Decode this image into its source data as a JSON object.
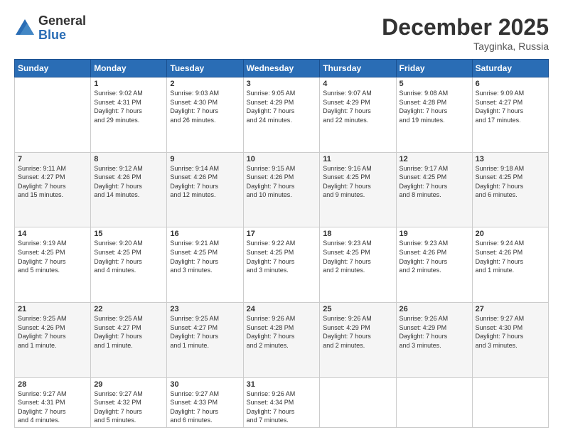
{
  "logo": {
    "general": "General",
    "blue": "Blue"
  },
  "header": {
    "month": "December 2025",
    "location": "Tayginka, Russia"
  },
  "weekdays": [
    "Sunday",
    "Monday",
    "Tuesday",
    "Wednesday",
    "Thursday",
    "Friday",
    "Saturday"
  ],
  "weeks": [
    [
      {
        "day": "",
        "info": ""
      },
      {
        "day": "1",
        "info": "Sunrise: 9:02 AM\nSunset: 4:31 PM\nDaylight: 7 hours\nand 29 minutes."
      },
      {
        "day": "2",
        "info": "Sunrise: 9:03 AM\nSunset: 4:30 PM\nDaylight: 7 hours\nand 26 minutes."
      },
      {
        "day": "3",
        "info": "Sunrise: 9:05 AM\nSunset: 4:29 PM\nDaylight: 7 hours\nand 24 minutes."
      },
      {
        "day": "4",
        "info": "Sunrise: 9:07 AM\nSunset: 4:29 PM\nDaylight: 7 hours\nand 22 minutes."
      },
      {
        "day": "5",
        "info": "Sunrise: 9:08 AM\nSunset: 4:28 PM\nDaylight: 7 hours\nand 19 minutes."
      },
      {
        "day": "6",
        "info": "Sunrise: 9:09 AM\nSunset: 4:27 PM\nDaylight: 7 hours\nand 17 minutes."
      }
    ],
    [
      {
        "day": "7",
        "info": "Sunrise: 9:11 AM\nSunset: 4:27 PM\nDaylight: 7 hours\nand 15 minutes."
      },
      {
        "day": "8",
        "info": "Sunrise: 9:12 AM\nSunset: 4:26 PM\nDaylight: 7 hours\nand 14 minutes."
      },
      {
        "day": "9",
        "info": "Sunrise: 9:14 AM\nSunset: 4:26 PM\nDaylight: 7 hours\nand 12 minutes."
      },
      {
        "day": "10",
        "info": "Sunrise: 9:15 AM\nSunset: 4:26 PM\nDaylight: 7 hours\nand 10 minutes."
      },
      {
        "day": "11",
        "info": "Sunrise: 9:16 AM\nSunset: 4:25 PM\nDaylight: 7 hours\nand 9 minutes."
      },
      {
        "day": "12",
        "info": "Sunrise: 9:17 AM\nSunset: 4:25 PM\nDaylight: 7 hours\nand 8 minutes."
      },
      {
        "day": "13",
        "info": "Sunrise: 9:18 AM\nSunset: 4:25 PM\nDaylight: 7 hours\nand 6 minutes."
      }
    ],
    [
      {
        "day": "14",
        "info": "Sunrise: 9:19 AM\nSunset: 4:25 PM\nDaylight: 7 hours\nand 5 minutes."
      },
      {
        "day": "15",
        "info": "Sunrise: 9:20 AM\nSunset: 4:25 PM\nDaylight: 7 hours\nand 4 minutes."
      },
      {
        "day": "16",
        "info": "Sunrise: 9:21 AM\nSunset: 4:25 PM\nDaylight: 7 hours\nand 3 minutes."
      },
      {
        "day": "17",
        "info": "Sunrise: 9:22 AM\nSunset: 4:25 PM\nDaylight: 7 hours\nand 3 minutes."
      },
      {
        "day": "18",
        "info": "Sunrise: 9:23 AM\nSunset: 4:25 PM\nDaylight: 7 hours\nand 2 minutes."
      },
      {
        "day": "19",
        "info": "Sunrise: 9:23 AM\nSunset: 4:26 PM\nDaylight: 7 hours\nand 2 minutes."
      },
      {
        "day": "20",
        "info": "Sunrise: 9:24 AM\nSunset: 4:26 PM\nDaylight: 7 hours\nand 1 minute."
      }
    ],
    [
      {
        "day": "21",
        "info": "Sunrise: 9:25 AM\nSunset: 4:26 PM\nDaylight: 7 hours\nand 1 minute."
      },
      {
        "day": "22",
        "info": "Sunrise: 9:25 AM\nSunset: 4:27 PM\nDaylight: 7 hours\nand 1 minute."
      },
      {
        "day": "23",
        "info": "Sunrise: 9:25 AM\nSunset: 4:27 PM\nDaylight: 7 hours\nand 1 minute."
      },
      {
        "day": "24",
        "info": "Sunrise: 9:26 AM\nSunset: 4:28 PM\nDaylight: 7 hours\nand 2 minutes."
      },
      {
        "day": "25",
        "info": "Sunrise: 9:26 AM\nSunset: 4:29 PM\nDaylight: 7 hours\nand 2 minutes."
      },
      {
        "day": "26",
        "info": "Sunrise: 9:26 AM\nSunset: 4:29 PM\nDaylight: 7 hours\nand 3 minutes."
      },
      {
        "day": "27",
        "info": "Sunrise: 9:27 AM\nSunset: 4:30 PM\nDaylight: 7 hours\nand 3 minutes."
      }
    ],
    [
      {
        "day": "28",
        "info": "Sunrise: 9:27 AM\nSunset: 4:31 PM\nDaylight: 7 hours\nand 4 minutes."
      },
      {
        "day": "29",
        "info": "Sunrise: 9:27 AM\nSunset: 4:32 PM\nDaylight: 7 hours\nand 5 minutes."
      },
      {
        "day": "30",
        "info": "Sunrise: 9:27 AM\nSunset: 4:33 PM\nDaylight: 7 hours\nand 6 minutes."
      },
      {
        "day": "31",
        "info": "Sunrise: 9:26 AM\nSunset: 4:34 PM\nDaylight: 7 hours\nand 7 minutes."
      },
      {
        "day": "",
        "info": ""
      },
      {
        "day": "",
        "info": ""
      },
      {
        "day": "",
        "info": ""
      }
    ]
  ]
}
